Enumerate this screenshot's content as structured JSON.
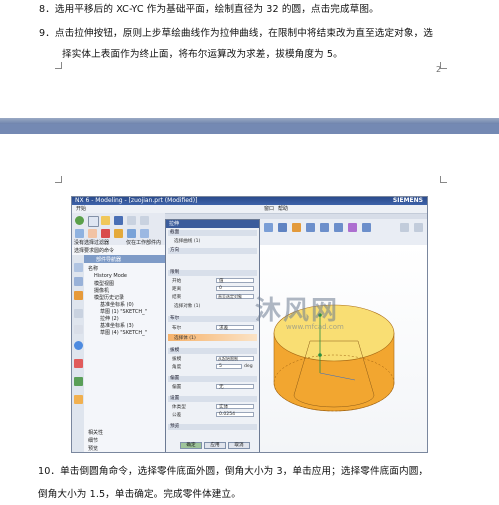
{
  "page1": {
    "step8": "8．选用平移后的 XC-YC 作为基础平面，绘制直径为 32 的圆，点击完成草图。",
    "step9_line1": "9．点击拉伸按钮，原则上步草绘曲线作为拉伸曲线，在限制中将结束改为直至选定对象，选",
    "step9_line2": "择实体上表面作为终止面，将布尔运算改为求差，拔模角度为 5。",
    "page_number": "2"
  },
  "screenshot": {
    "app_title": "NX 6 - Modeling - [zuojian.prt (Modified)]",
    "brand": "SIEMENS",
    "menus": [
      "开始",
      "文件",
      "编辑",
      "视图",
      "插入",
      "格式",
      "工具",
      "装配",
      "信息",
      "分析",
      "首选项",
      "窗口",
      "帮助"
    ],
    "dialog": {
      "title": "拉伸",
      "section_label": "选择曲线 (1)",
      "groups": [
        "截面",
        "方向",
        "限制",
        "布尔",
        "拔模",
        "偏置",
        "设置",
        "预览"
      ],
      "limit_start": "开始",
      "limit_start_value": "值",
      "distance_label": "距离",
      "distance_value": "0",
      "end_label": "结束",
      "end_value": "直至选定对象",
      "select_object": "选择对象 (1)",
      "boolean_label": "布尔",
      "boolean_value": "求差",
      "select_body": "选择体 (1)",
      "draft_label": "拔模",
      "draft_value": "从起始限制",
      "angle_label": "角度",
      "angle_value": "5",
      "angle_unit": "deg",
      "offset_label": "偏置",
      "offset_value": "无",
      "body_type_label": "体类型",
      "body_type_value": "实体",
      "tolerance_label": "公差",
      "tolerance_value": "0.0254",
      "ok": "确定",
      "apply": "应用",
      "cancel": "取消"
    },
    "nav": {
      "filter": "没有选择过滤器",
      "scope": "仅在工作部件内",
      "title": "选择要求圆的命令",
      "panel_title": "部件导航器",
      "column": "名称",
      "items": [
        "History Mode",
        "模型视图",
        "摄像机",
        "模型历史记录",
        "基准坐标系 (0)",
        "草图 (1) \"SKETCH_\"",
        "拉伸 (2)",
        "基准坐标系 (3)",
        "草图 (4) \"SKETCH_\""
      ],
      "bottom": [
        "相关性",
        "细节",
        "预览"
      ]
    },
    "toolbar_labels": [
      "圆柱体",
      "孔",
      "拉伸",
      "拔模",
      "边倒圆",
      "倒斜角",
      "修剪体",
      "镜像特征",
      "曲线",
      "特征"
    ],
    "watermark": "沐风网",
    "watermark_url": "www.mfcad.com"
  },
  "page2": {
    "step10_line1": "10．单击倒圆角命令，选择零件底面外圆，倒角大小为 3，单击应用；选择零件底面内圆，",
    "step10_line2": "倒角大小为 1.5，单击确定。完成零件体建立。"
  },
  "colors": {
    "separator": "#7489b3",
    "part_body": "#f2a630",
    "part_top": "#f9de73",
    "dialog_title": "#3b5c9c"
  }
}
